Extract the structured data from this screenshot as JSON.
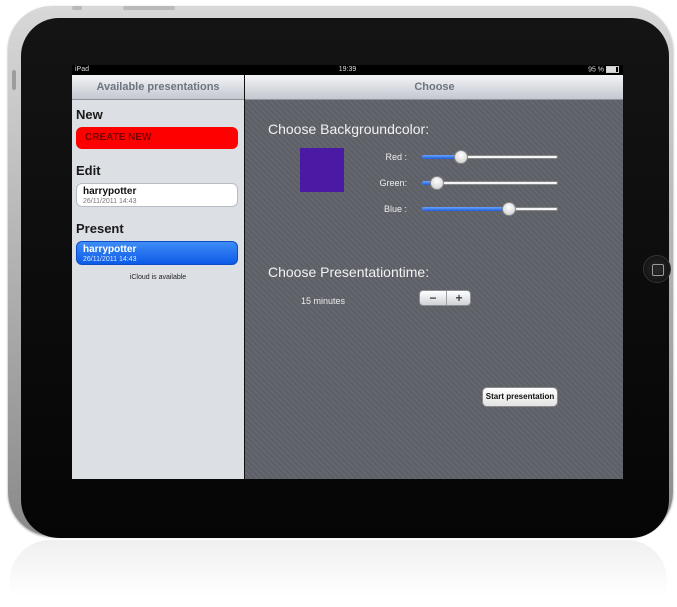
{
  "status_bar": {
    "carrier": "iPad",
    "time": "19:39",
    "battery": "95 %"
  },
  "master": {
    "title": "Available presentations",
    "new_section": "New",
    "create_button": "CREATE NEW",
    "edit_section": "Edit",
    "edit_item": {
      "title": "harrypotter",
      "date": "26/11/2011 14:43"
    },
    "present_section": "Present",
    "present_item": {
      "title": "harrypotter",
      "date": "26/11/2011 14:43"
    },
    "icloud_note": "iCloud is available"
  },
  "detail": {
    "title": "Choose",
    "bg_heading": "Choose Backgroundcolor:",
    "swatch_color": "#4a1aa4",
    "sliders": [
      {
        "label": "Red :",
        "value": 0.29
      },
      {
        "label": "Green:",
        "value": 0.11
      },
      {
        "label": "Blue :",
        "value": 0.64
      }
    ],
    "time_heading": "Choose Presentationtime:",
    "time_value": "15 minutes",
    "stepper_minus": "−",
    "stepper_plus": "+",
    "start_button": "Start presentation"
  },
  "colors": {
    "accent_blue": "#1d5ed8",
    "create_red": "#ff0000"
  }
}
